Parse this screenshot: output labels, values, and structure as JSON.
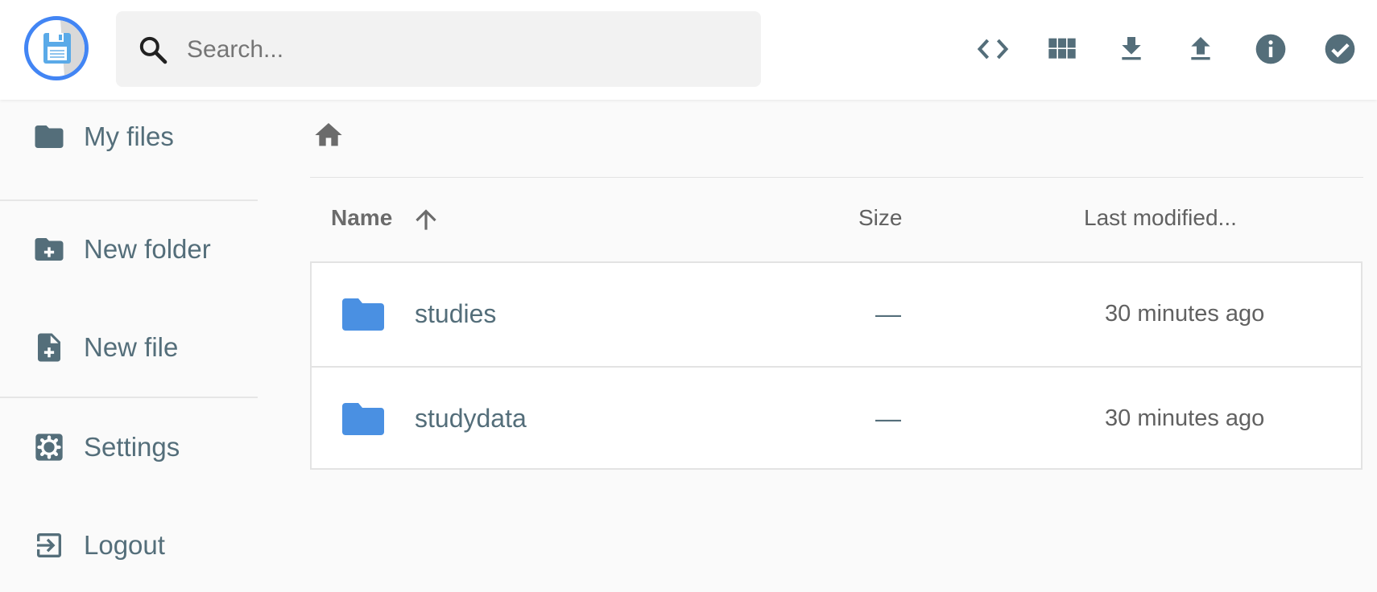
{
  "header": {
    "search_placeholder": "Search...",
    "actions": [
      {
        "icon": "code-icon"
      },
      {
        "icon": "grid-view-icon"
      },
      {
        "icon": "download-icon"
      },
      {
        "icon": "upload-icon"
      },
      {
        "icon": "info-icon"
      },
      {
        "icon": "check-circle-icon"
      }
    ]
  },
  "sidebar": {
    "items": [
      {
        "label": "My files",
        "icon": "folder-icon"
      },
      {
        "label": "New folder",
        "icon": "folder-add-icon"
      },
      {
        "label": "New file",
        "icon": "file-add-icon"
      },
      {
        "label": "Settings",
        "icon": "settings-icon"
      },
      {
        "label": "Logout",
        "icon": "logout-icon"
      }
    ]
  },
  "listing": {
    "columns": {
      "name": "Name",
      "size": "Size",
      "modified": "Last modified..."
    },
    "rows": [
      {
        "name": "studies",
        "size": "—",
        "modified": "30 minutes ago",
        "icon": "folder-icon"
      },
      {
        "name": "studydata",
        "size": "—",
        "modified": "30 minutes ago",
        "icon": "folder-icon"
      }
    ]
  },
  "colors": {
    "accent": "#4285f4",
    "icon": "#546e7a",
    "folder": "#4a90e2"
  }
}
